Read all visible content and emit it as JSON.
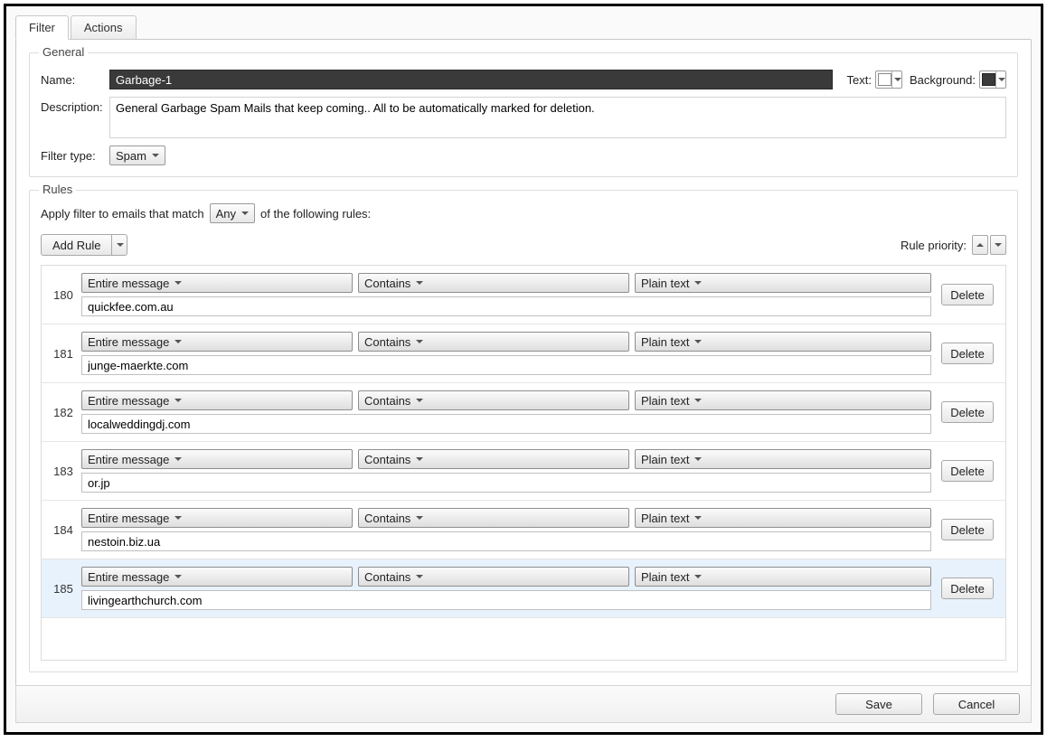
{
  "tabs": {
    "filter": "Filter",
    "actions": "Actions"
  },
  "general": {
    "legend": "General",
    "name_label": "Name:",
    "name_value": "Garbage-1",
    "text_label": "Text:",
    "background_label": "Background:",
    "text_color": "#ffffff",
    "background_color": "#3a3a3a",
    "description_label": "Description:",
    "description_value": "General Garbage Spam Mails that keep coming.. All to be automatically marked for deletion.",
    "filter_type_label": "Filter type:",
    "filter_type_value": "Spam"
  },
  "rules_section": {
    "legend": "Rules",
    "match_prefix": "Apply filter to emails that match",
    "match_mode": "Any",
    "match_suffix": "of the following rules:",
    "add_rule_label": "Add Rule",
    "priority_label": "Rule priority:",
    "delete_label": "Delete"
  },
  "rules": [
    {
      "index": "180",
      "field": "Entire message",
      "op": "Contains",
      "fmt": "Plain text",
      "value": "quickfee.com.au",
      "selected": false
    },
    {
      "index": "181",
      "field": "Entire message",
      "op": "Contains",
      "fmt": "Plain text",
      "value": "junge-maerkte.com",
      "selected": false
    },
    {
      "index": "182",
      "field": "Entire message",
      "op": "Contains",
      "fmt": "Plain text",
      "value": "localweddingdj.com",
      "selected": false
    },
    {
      "index": "183",
      "field": "Entire message",
      "op": "Contains",
      "fmt": "Plain text",
      "value": "or.jp",
      "selected": false
    },
    {
      "index": "184",
      "field": "Entire message",
      "op": "Contains",
      "fmt": "Plain text",
      "value": "nestoin.biz.ua",
      "selected": false
    },
    {
      "index": "185",
      "field": "Entire message",
      "op": "Contains",
      "fmt": "Plain text",
      "value": "livingearthchurch.com",
      "selected": true
    }
  ],
  "footer": {
    "save": "Save",
    "cancel": "Cancel"
  }
}
